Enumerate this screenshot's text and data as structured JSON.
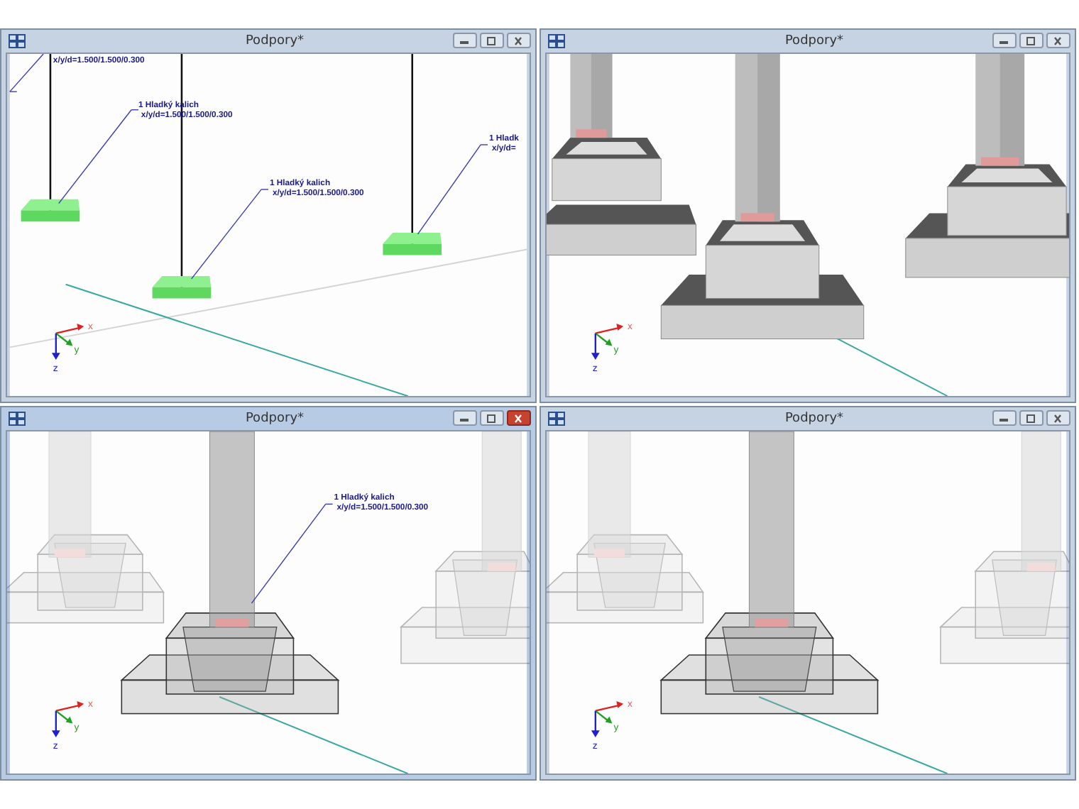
{
  "windows": [
    {
      "title": "Podpory*",
      "active": false,
      "kind": "pads",
      "labels": [
        {
          "lines": [
            "x/y/d=1.500/1.500/0.300"
          ]
        },
        {
          "lines": [
            "1 Hladký kalich",
            "x/y/d=1.500/1.500/0.300"
          ]
        },
        {
          "lines": [
            "1 Hladký kalich",
            "x/y/d=1.500/1.500/0.300"
          ]
        },
        {
          "lines": [
            "1 Hladk",
            "x/y/d="
          ]
        }
      ],
      "axes": [
        "x",
        "y",
        "z"
      ]
    },
    {
      "title": "Podpory*",
      "active": false,
      "kind": "solid",
      "axes": [
        "x",
        "y",
        "z"
      ]
    },
    {
      "title": "Podpory*",
      "active": true,
      "kind": "transparent",
      "labels": [
        {
          "lines": [
            "1 Hladký kalich",
            "x/y/d=1.500/1.500/0.300"
          ]
        }
      ],
      "axes": [
        "x",
        "y",
        "z"
      ]
    },
    {
      "title": "Podpory*",
      "active": false,
      "kind": "transparent",
      "axes": [
        "x",
        "y",
        "z"
      ]
    }
  ]
}
